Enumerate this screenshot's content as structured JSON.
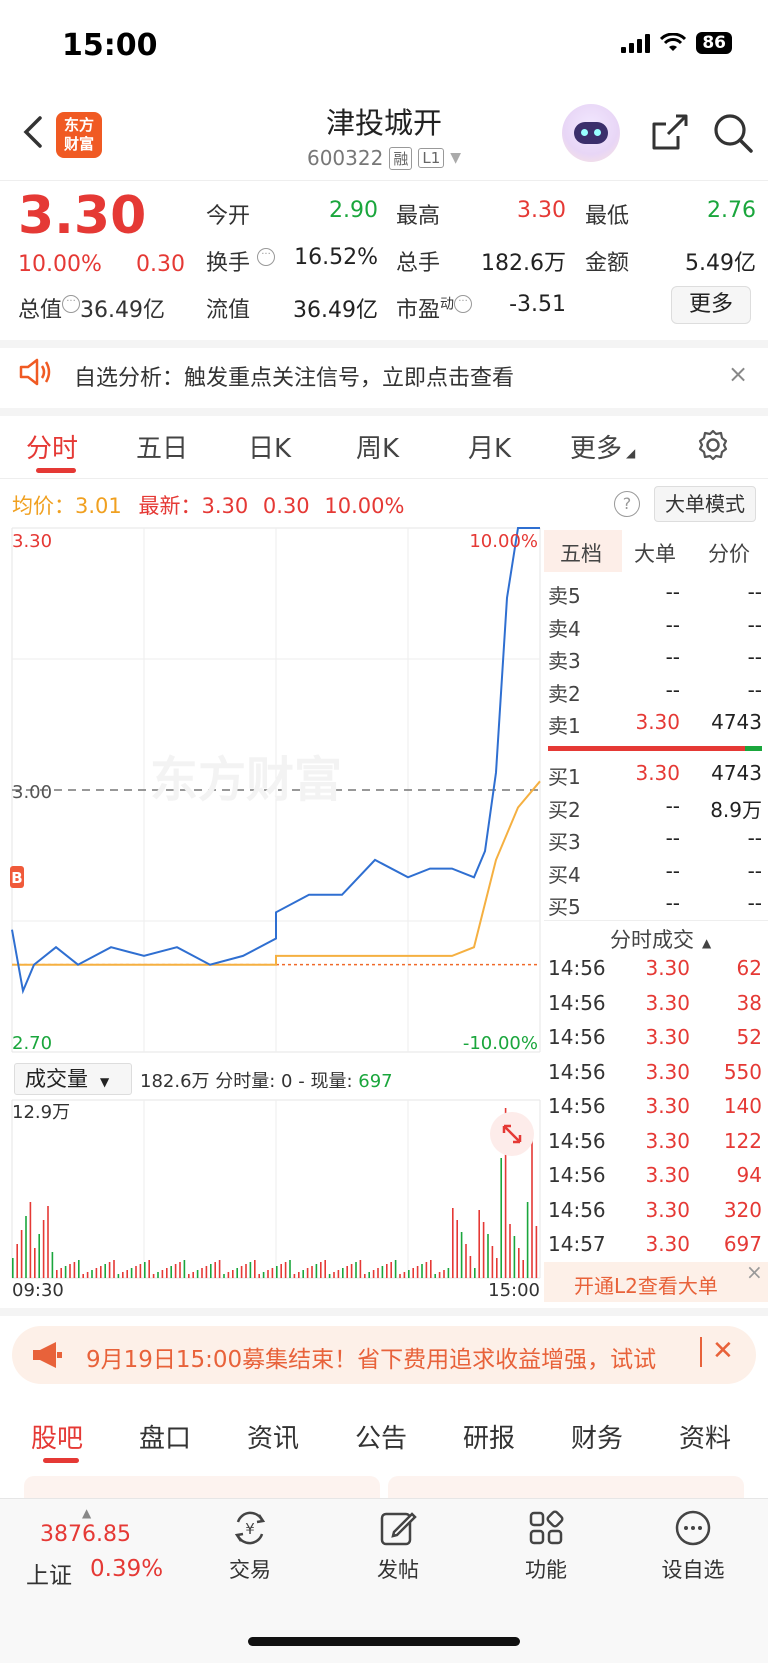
{
  "status": {
    "time": "15:00",
    "battery": "86"
  },
  "header": {
    "logo": "东方财富",
    "name": "津投城开",
    "code": "600322",
    "tag_rong": "融",
    "tag_level": "L1"
  },
  "quote": {
    "price": "3.30",
    "pct": "10.00%",
    "chg": "0.30",
    "open_label": "今开",
    "open": "2.90",
    "high_label": "最高",
    "high": "3.30",
    "low_label": "最低",
    "low": "2.76",
    "turnover_label": "换手",
    "turnover": "16.52%",
    "volume_label": "总手",
    "volume": "182.6万",
    "amount_label": "金额",
    "amount": "5.49亿",
    "mktcap_label": "总值",
    "mktcap": "36.49亿",
    "float_label": "流值",
    "float": "36.49亿",
    "pe_label": "市盈",
    "pe_sup": "动",
    "pe": "-3.51",
    "more": "更多"
  },
  "alert": {
    "text": "自选分析：触发重点关注信号，立即点击查看",
    "close": "×"
  },
  "tabs": [
    "分时",
    "五日",
    "日K",
    "周K",
    "月K",
    "更多"
  ],
  "chart_head": {
    "avg_label": "均价：",
    "avg": "3.01",
    "last_label": "最新：",
    "last": "3.30",
    "chg": "0.30",
    "pct": "10.00%",
    "help": "?",
    "bigmode": "大单模式"
  },
  "chart_labels": {
    "ymax": "3.30",
    "ymid": "3.00",
    "ymin": "2.70",
    "pmax": "10.00%",
    "pmin": "-10.00%",
    "marker": "B",
    "watermark": "东方财富",
    "vol_max": "12.9万",
    "t_start": "09:30",
    "t_end": "15:00"
  },
  "volume_bar": {
    "select": "成交量",
    "total": "182.6万",
    "split_label": "分时量: 0 - 现量:",
    "current": "697"
  },
  "orderbook": {
    "tabs": [
      "五档",
      "大单",
      "分价"
    ],
    "asks": [
      {
        "label": "卖5",
        "price": "--",
        "vol": "--"
      },
      {
        "label": "卖4",
        "price": "--",
        "vol": "--"
      },
      {
        "label": "卖3",
        "price": "--",
        "vol": "--"
      },
      {
        "label": "卖2",
        "price": "--",
        "vol": "--"
      },
      {
        "label": "卖1",
        "price": "3.30",
        "vol": "4743"
      }
    ],
    "bids": [
      {
        "label": "买1",
        "price": "3.30",
        "vol": "4743"
      },
      {
        "label": "买2",
        "price": "--",
        "vol": "8.9万"
      },
      {
        "label": "买3",
        "price": "--",
        "vol": "--"
      },
      {
        "label": "买4",
        "price": "--",
        "vol": "--"
      },
      {
        "label": "买5",
        "price": "--",
        "vol": "--"
      }
    ],
    "trades_title": "分时成交",
    "trades": [
      {
        "t": "14:56",
        "p": "3.30",
        "v": "62",
        "dir": "up"
      },
      {
        "t": "14:56",
        "p": "3.30",
        "v": "38",
        "dir": "up"
      },
      {
        "t": "14:56",
        "p": "3.30",
        "v": "52",
        "dir": "up"
      },
      {
        "t": "14:56",
        "p": "3.30",
        "v": "550",
        "dir": "up"
      },
      {
        "t": "14:56",
        "p": "3.30",
        "v": "140",
        "dir": "up"
      },
      {
        "t": "14:56",
        "p": "3.30",
        "v": "122",
        "dir": "up"
      },
      {
        "t": "14:56",
        "p": "3.30",
        "v": "94",
        "dir": "up"
      },
      {
        "t": "14:56",
        "p": "3.30",
        "v": "320",
        "dir": "up"
      },
      {
        "t": "14:57",
        "p": "3.30",
        "v": "697",
        "dir": "up"
      }
    ],
    "l2_promo": "开通L2查看大单"
  },
  "promo": {
    "text": "9月19日15:00募集结束！省下费用追求收益增强，试试"
  },
  "bottom_tabs": [
    "股吧",
    "盘口",
    "资讯",
    "公告",
    "研报",
    "财务",
    "资料"
  ],
  "bottom_bar": {
    "index_value": "3876.85",
    "index_name": "上证",
    "index_pct": "0.39%",
    "nav": [
      "交易",
      "发帖",
      "功能",
      "设自选"
    ]
  },
  "colors": {
    "up": "#e53935",
    "down": "#1aa63c",
    "price_line": "#2f6fd1",
    "avg_line": "#f5b041",
    "brand": "#f05a23"
  },
  "chart_data": {
    "type": "line",
    "x_range": [
      "09:30",
      "15:00"
    ],
    "ylim": [
      2.7,
      3.3
    ],
    "pct_range": [
      "-10.00%",
      "10.00%"
    ],
    "prev_close": 3.0,
    "series": [
      {
        "x": [
          "09:30",
          "09:35",
          "09:40",
          "09:50",
          "10:00",
          "10:15",
          "10:30",
          "10:45",
          "11:00",
          "11:15",
          "11:30",
          "13:00",
          "13:15",
          "13:30",
          "13:45",
          "14:00",
          "14:10",
          "14:20",
          "14:30",
          "14:35",
          "14:40",
          "14:45",
          "14:50",
          "15:00"
        ],
        "values": [
          2.84,
          2.77,
          2.8,
          2.82,
          2.8,
          2.82,
          2.81,
          2.82,
          2.8,
          2.81,
          2.83,
          2.86,
          2.88,
          2.88,
          2.92,
          2.9,
          2.91,
          2.91,
          2.9,
          2.93,
          3.02,
          3.22,
          3.3,
          3.3
        ]
      },
      {
        "x": [
          "09:30",
          "10:00",
          "11:00",
          "11:30",
          "13:00",
          "13:30",
          "14:00",
          "14:20",
          "14:30",
          "14:40",
          "14:50",
          "15:00"
        ],
        "values": [
          2.8,
          2.8,
          2.8,
          2.8,
          2.81,
          2.81,
          2.81,
          2.81,
          2.82,
          2.92,
          2.98,
          3.01
        ]
      }
    ],
    "volume_max": "12.9万"
  }
}
